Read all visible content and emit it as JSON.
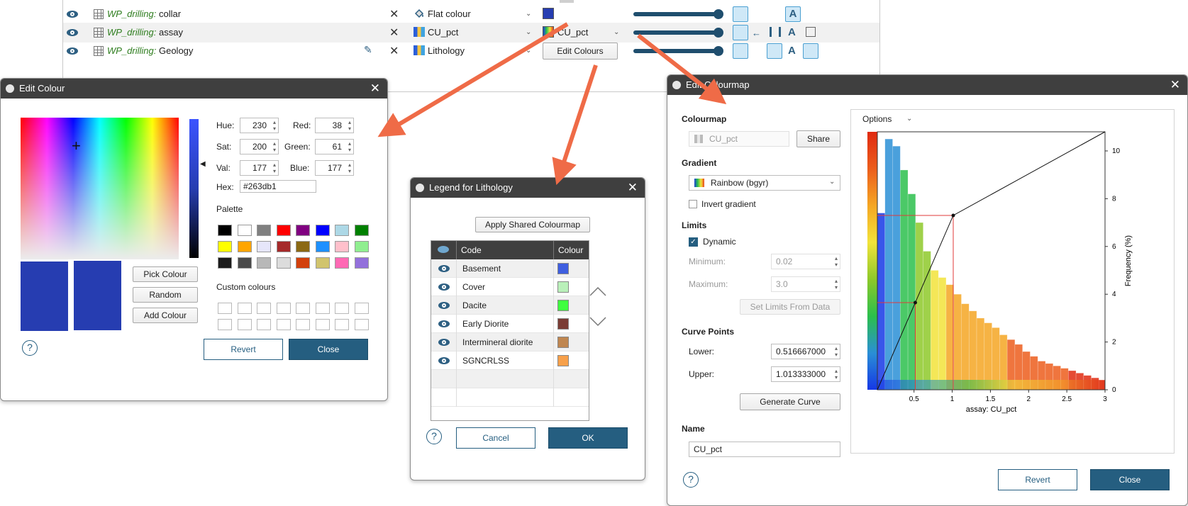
{
  "toppanel": {
    "rows": [
      {
        "object_prefix": "WP_drilling:",
        "object_name": "collar",
        "colour_mode": "Flat colour",
        "colour_swatch": "#263db1"
      },
      {
        "object_prefix": "WP_drilling:",
        "object_name": "assay",
        "colour_mode": "CU_pct",
        "colourmap_label": "CU_pct"
      },
      {
        "object_prefix": "WP_drilling:",
        "object_name": "Geology",
        "colour_mode": "Lithology",
        "edit_colours_label": "Edit Colours"
      }
    ]
  },
  "edit_colour": {
    "title": "Edit Colour",
    "hue_label": "Hue:",
    "hue": "230",
    "sat_label": "Sat:",
    "sat": "200",
    "val_label": "Val:",
    "val": "177",
    "red_label": "Red:",
    "red": "38",
    "green_label": "Green:",
    "green": "61",
    "blue_label": "Blue:",
    "blue": "177",
    "hex_label": "Hex:",
    "hex": "#263db1",
    "palette_label": "Palette",
    "palette_colors": [
      "#000000",
      "#ffffff",
      "#808080",
      "#ff0000",
      "#800080",
      "#0000ff",
      "#add8e6",
      "#008000",
      "#ffff00",
      "#ffa500",
      "#e6e6fa",
      "#a52a2a",
      "#8b6914",
      "#1e90ff",
      "#ffc0cb",
      "#90ee90",
      "#1c1c1c",
      "#4a4a4a",
      "#b8b8b8",
      "#dcdcdc",
      "#d2400c",
      "#d1c46d",
      "#ff69b4",
      "#9370db"
    ],
    "custom_colours_label": "Custom colours",
    "pick_colour": "Pick Colour",
    "random": "Random",
    "add_colour": "Add Colour",
    "revert": "Revert",
    "close": "Close",
    "current_color": "#263db1"
  },
  "legend": {
    "title": "Legend for Lithology",
    "apply_shared": "Apply Shared Colourmap",
    "col_code": "Code",
    "col_colour": "Colour",
    "rows": [
      {
        "code": "Basement",
        "color": "#3f5fe0"
      },
      {
        "code": "Cover",
        "color": "#b9f0b9"
      },
      {
        "code": "Dacite",
        "color": "#3fff3f"
      },
      {
        "code": "Early Diorite",
        "color": "#7a3c34"
      },
      {
        "code": "Intermineral diorite",
        "color": "#bf8650"
      },
      {
        "code": "SGNCRLSS",
        "color": "#f7a04a"
      }
    ],
    "cancel": "Cancel",
    "ok": "OK"
  },
  "colourmap": {
    "title": "Edit Colourmap",
    "colourmap_section": "Colourmap",
    "colourmap_name": "CU_pct",
    "share": "Share",
    "gradient_section": "Gradient",
    "gradient_name": "Rainbow (bgyr)",
    "invert_gradient": "Invert gradient",
    "limits_section": "Limits",
    "dynamic": "Dynamic",
    "minimum_label": "Minimum:",
    "minimum": "0.02",
    "maximum_label": "Maximum:",
    "maximum": "3.0",
    "set_limits": "Set Limits From Data",
    "curve_section": "Curve Points",
    "lower_label": "Lower:",
    "lower": "0.516667000",
    "upper_label": "Upper:",
    "upper": "1.013333000",
    "generate_curve": "Generate Curve",
    "name_section": "Name",
    "name_value": "CU_pct",
    "options": "Options",
    "revert": "Revert",
    "close": "Close"
  },
  "chart_data": {
    "type": "bar",
    "xlabel": "assay: CU_pct",
    "ylabel": "Frequency (%)",
    "xlim": [
      0.02,
      3.0
    ],
    "ylim": [
      0,
      10.8
    ],
    "x_ticks": [
      "0.5",
      "1",
      "1.5",
      "2",
      "2.5",
      "3"
    ],
    "y_ticks": [
      "0",
      "2",
      "4",
      "6",
      "8",
      "10"
    ],
    "bin_width": 0.1,
    "bin_starts": [
      0.02,
      0.12,
      0.22,
      0.32,
      0.42,
      0.52,
      0.62,
      0.72,
      0.82,
      0.92,
      1.02,
      1.12,
      1.22,
      1.32,
      1.42,
      1.52,
      1.62,
      1.72,
      1.82,
      1.92,
      2.02,
      2.12,
      2.22,
      2.32,
      2.42,
      2.52,
      2.62,
      2.72,
      2.82,
      2.92
    ],
    "values": [
      7.4,
      10.5,
      10.2,
      9.2,
      8.2,
      7.0,
      5.8,
      5.0,
      4.7,
      4.4,
      4.0,
      3.6,
      3.3,
      3.0,
      2.8,
      2.6,
      2.3,
      2.1,
      1.9,
      1.6,
      1.4,
      1.2,
      1.1,
      1.0,
      0.9,
      0.8,
      0.7,
      0.6,
      0.5,
      0.4
    ],
    "curve_points": [
      [
        0.02,
        0
      ],
      [
        0.516667,
        3.65
      ],
      [
        1.013333,
        7.3
      ],
      [
        3.0,
        10.8
      ]
    ]
  }
}
